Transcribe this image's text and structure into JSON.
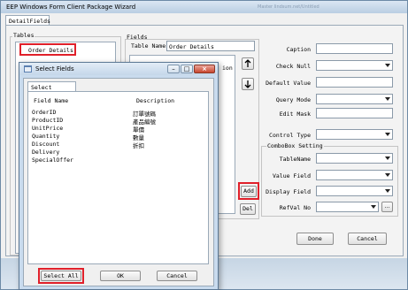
{
  "window": {
    "title": "EEP Windows Form Client Package Wizard",
    "background_text": "Master  lindsum.net/Untitled"
  },
  "outer_tab": "DetailFields",
  "tables_group": {
    "title": "Tables",
    "items": [
      "Order Details"
    ]
  },
  "fields_group": {
    "title": "Fields",
    "table_name_label": "Table Name:",
    "table_name_value": "Order Details",
    "partial_label": "ion",
    "add_label": "Add",
    "del_label": "Del"
  },
  "properties": {
    "caption_label": "Caption",
    "check_null_label": "Check Null",
    "default_value_label": "Default Value",
    "query_mode_label": "Query Mode",
    "edit_mask_label": "Edit Mask",
    "control_type_label": "Control Type",
    "combobox_title": "ComboBox Setting",
    "table_name_label": "TableName",
    "value_field_label": "Value Field",
    "display_field_label": "Display Field",
    "refval_no_label": "RefVal No",
    "ellipsis_label": "..."
  },
  "footer": {
    "done_label": "Done",
    "cancel_label": "Cancel"
  },
  "dialog": {
    "title": "Select Fields",
    "tab": "Select Fields",
    "col_field_name": "Field Name",
    "col_description": "Description",
    "rows": [
      {
        "name": "OrderID",
        "desc": "訂單號碼"
      },
      {
        "name": "ProductID",
        "desc": "產品編號"
      },
      {
        "name": "UnitPrice",
        "desc": "單價"
      },
      {
        "name": "Quantity",
        "desc": "數量"
      },
      {
        "name": "Discount",
        "desc": "折扣"
      },
      {
        "name": "Delivery",
        "desc": ""
      },
      {
        "name": "SpecialOffer",
        "desc": ""
      }
    ],
    "select_all_label": "Select All",
    "ok_label": "OK",
    "cancel_label": "Cancel",
    "min_glyph": "–",
    "max_glyph": "□",
    "close_glyph": "×"
  },
  "icons": {
    "up": "up-arrow-icon",
    "down": "down-arrow-icon",
    "combo": "chevron-down-icon",
    "accent_red": "#e0202a"
  }
}
